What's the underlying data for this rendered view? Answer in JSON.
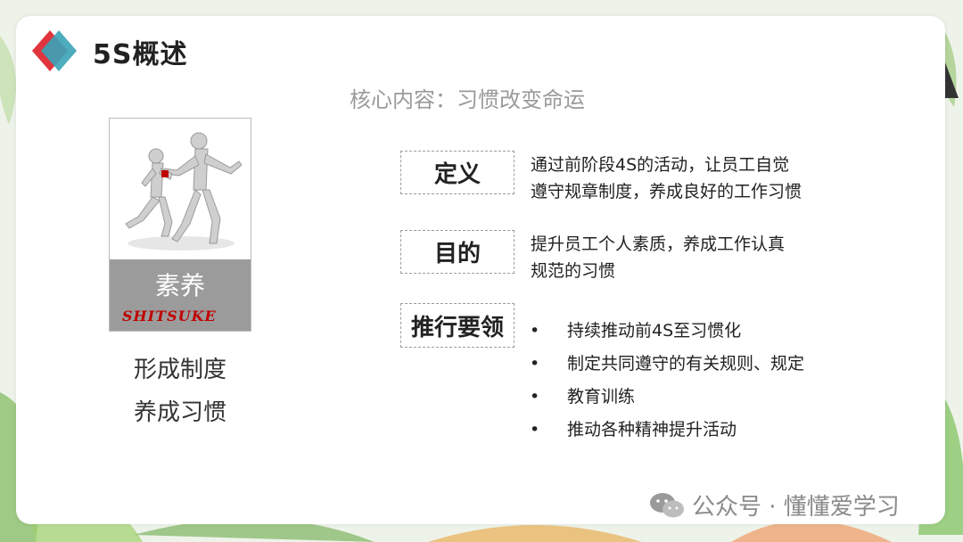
{
  "header": {
    "title": "5S概述"
  },
  "subtitle": "核心内容：习惯改变命运",
  "figure": {
    "cn_label": "素养",
    "en_label": "SHITSUKE"
  },
  "captions": [
    "形成制度",
    "养成习惯"
  ],
  "sections": {
    "definition": {
      "label": "定义",
      "lines": [
        "通过前阶段4S的活动，让员工自觉",
        "遵守规章制度，养成良好的工作习惯"
      ]
    },
    "purpose": {
      "label": "目的",
      "lines": [
        "提升员工个人素质，养成工作认真",
        "规范的习惯"
      ]
    },
    "practice": {
      "label": "推行要领",
      "bullet": "•",
      "items": [
        "持续推动前4S至习惯化",
        "制定共同遵守的有关规则、规定",
        "教育训练",
        "推动各种精神提升活动"
      ]
    }
  },
  "watermark": {
    "icon": "wechat-icon",
    "text": "公众号 · 懂懂爱学习"
  },
  "colors": {
    "logo_red": "#e0353d",
    "logo_teal": "#3aa3b7",
    "band_gray": "#9b9b9b",
    "accent_red": "#c00000"
  }
}
